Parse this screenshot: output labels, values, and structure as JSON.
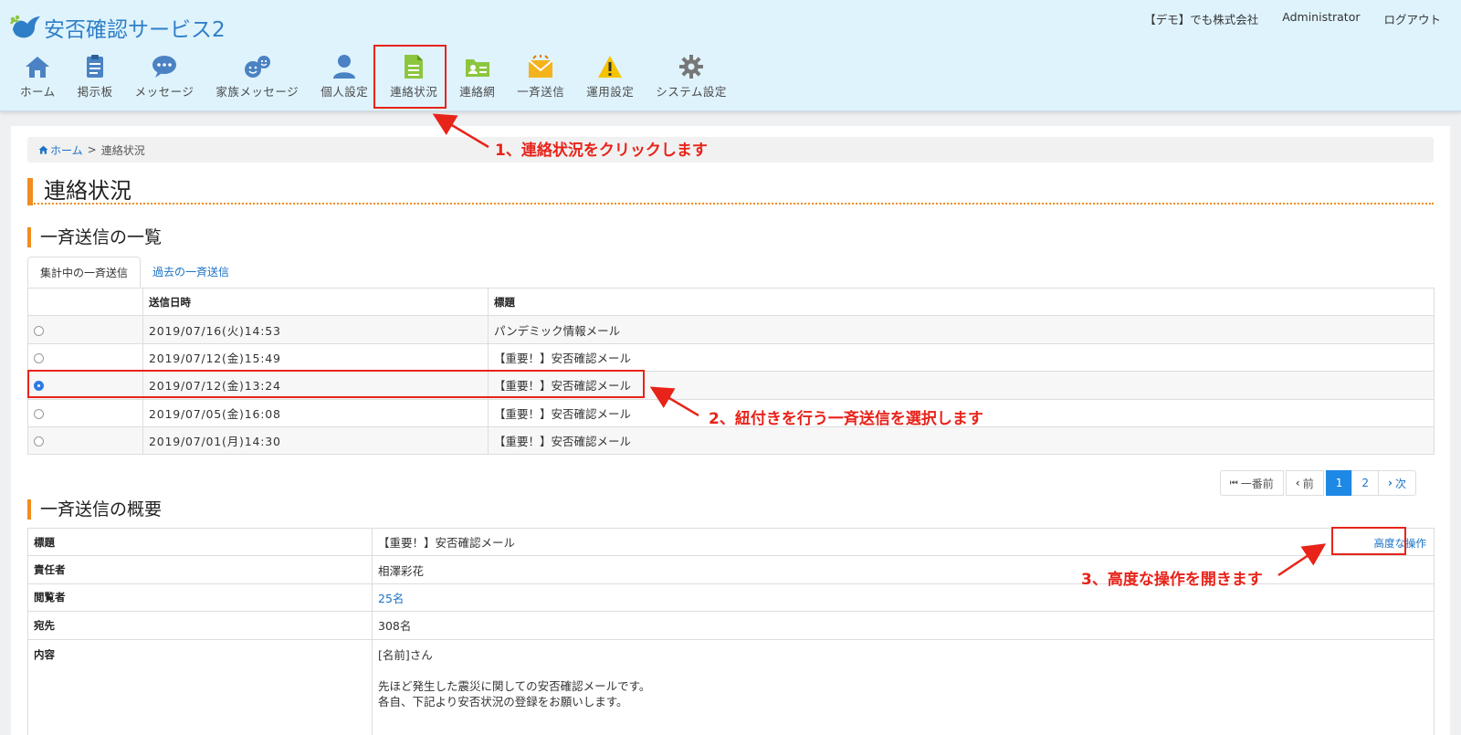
{
  "header": {
    "app_title": "安否確認サービス2",
    "company": "【デモ】でも株式会社",
    "user": "Administrator",
    "logout": "ログアウト"
  },
  "nav": [
    {
      "label": "ホーム",
      "icon": "home-icon"
    },
    {
      "label": "掲示板",
      "icon": "bulletin-board-icon"
    },
    {
      "label": "メッセージ",
      "icon": "message-bubble-icon"
    },
    {
      "label": "家族メッセージ",
      "icon": "family-message-icon"
    },
    {
      "label": "個人設定",
      "icon": "person-icon"
    },
    {
      "label": "連絡状況",
      "icon": "document-icon"
    },
    {
      "label": "連絡網",
      "icon": "contact-network-icon"
    },
    {
      "label": "一斉送信",
      "icon": "broadcast-mail-icon"
    },
    {
      "label": "運用設定",
      "icon": "warning-icon"
    },
    {
      "label": "システム設定",
      "icon": "gear-icon"
    }
  ],
  "breadcrumb": {
    "home": "ホーム",
    "separator": ">",
    "current": "連絡状況"
  },
  "page_title": "連絡状況",
  "list_section": {
    "title": "一斉送信の一覧",
    "tabs": [
      "集計中の一斉送信",
      "過去の一斉送信"
    ],
    "columns": [
      "",
      "送信日時",
      "標題"
    ],
    "rows": [
      {
        "date": "2019/07/16(火)14:53",
        "subject": "パンデミック情報メール",
        "selected": false
      },
      {
        "date": "2019/07/12(金)15:49",
        "subject": "【重要！】安否確認メール",
        "selected": false
      },
      {
        "date": "2019/07/12(金)13:24",
        "subject": "【重要！】安否確認メール",
        "selected": true
      },
      {
        "date": "2019/07/05(金)16:08",
        "subject": "【重要！】安否確認メール",
        "selected": false
      },
      {
        "date": "2019/07/01(月)14:30",
        "subject": "【重要！】安否確認メール",
        "selected": false
      }
    ]
  },
  "pagination": {
    "first": "一番前",
    "prev": "前",
    "pages": [
      "1",
      "2"
    ],
    "current": "1",
    "next": "次"
  },
  "detail_section": {
    "title": "一斉送信の概要",
    "advanced_link": "高度な操作",
    "rows": [
      {
        "label": "標題",
        "value": "【重要！】安否確認メール"
      },
      {
        "label": "責任者",
        "value": "相澤彩花"
      },
      {
        "label": "閲覧者",
        "value": "25名"
      },
      {
        "label": "宛先",
        "value": "308名"
      },
      {
        "label": "内容",
        "lines": [
          "[名前]さん",
          "",
          "先ほど発生した震災に関しての安否確認メールです。",
          "各自、下記より安否状況の登録をお願いします。"
        ]
      }
    ]
  },
  "annotations": {
    "step1": "1、連絡状況をクリックします",
    "step2": "2、紐付きを行う一斉送信を選択します",
    "step3": "3、高度な操作を開きます"
  },
  "colors": {
    "accent": "#f18c1e",
    "link": "#1a73c8",
    "annotation": "#e8231a",
    "header_bg": "#dff3fd"
  }
}
